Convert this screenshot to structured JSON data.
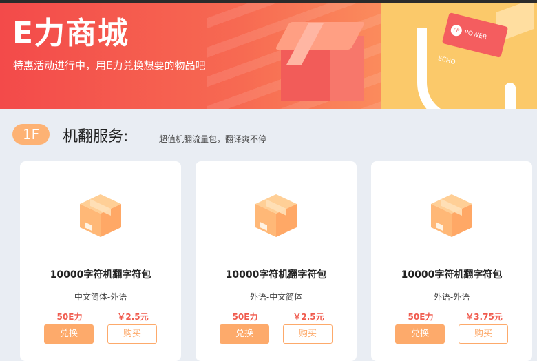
{
  "banner": {
    "title": "E力商城",
    "subtitle": "特惠活动进行中，用E力兑换想要的物品吧",
    "sign_logo": "PE",
    "sign_text": "POWER ECHO"
  },
  "floor": {
    "badge": "1F",
    "title": "机翻服务:",
    "description": "超值机翻流量包，翻译爽不停"
  },
  "products": [
    {
      "name": "10000字符机翻字符包",
      "lang": "中文简体-外语",
      "points": "50E力",
      "price": "￥2.5元",
      "redeem_label": "兑换",
      "buy_label": "购买"
    },
    {
      "name": "10000字符机翻字符包",
      "lang": "外语-中文简体",
      "points": "50E力",
      "price": "￥2.5元",
      "redeem_label": "兑换",
      "buy_label": "购买"
    },
    {
      "name": "10000字符机翻字符包",
      "lang": "外语-外语",
      "points": "50E力",
      "price": "￥3.75元",
      "redeem_label": "兑换",
      "buy_label": "购买"
    }
  ],
  "colors": {
    "accent": "#fdaa6b",
    "price": "#f05b4e",
    "banner_start": "#f34a4a",
    "banner_end": "#fbb065"
  }
}
